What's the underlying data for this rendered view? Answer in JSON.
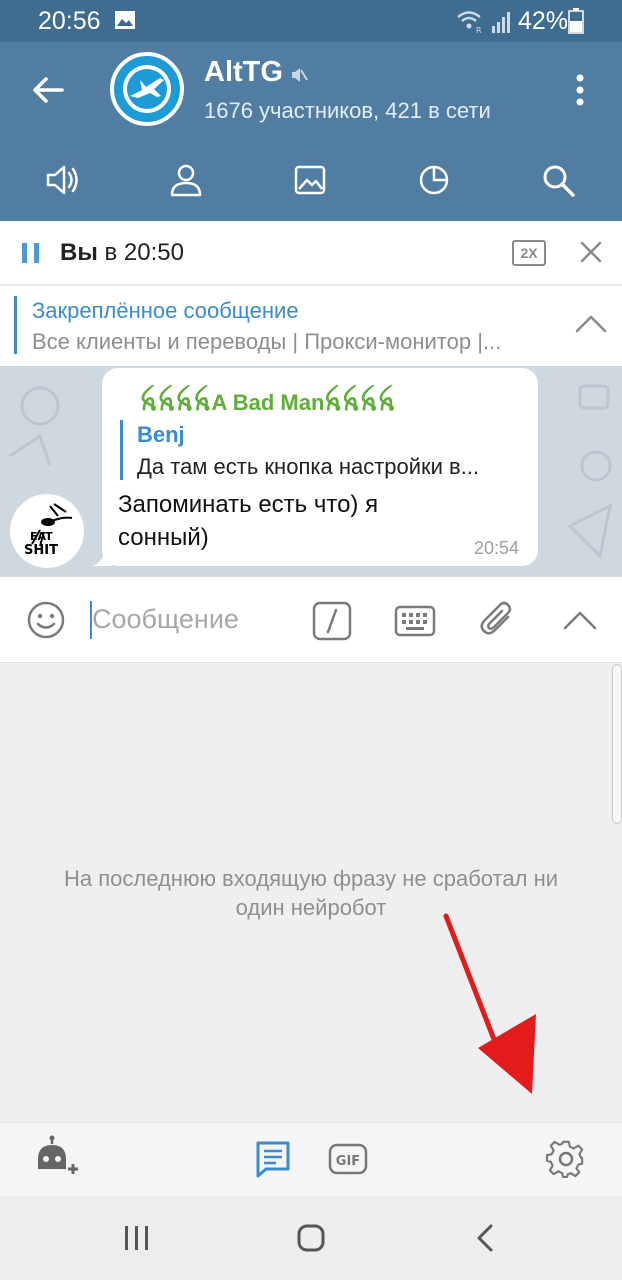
{
  "status_bar": {
    "time": "20:56",
    "battery": "42%"
  },
  "header": {
    "title": "AltTG",
    "subtitle": "1676 участников, 421 в сети",
    "tabs": [
      "audio",
      "members",
      "media",
      "history",
      "search"
    ]
  },
  "audio_player": {
    "prefix": "Вы",
    "time_text": " в 20:50",
    "speed": "2X"
  },
  "pinned": {
    "title": "Закреплённое сообщение",
    "text": "Все клиенты и переводы | Прокси-монитор |..."
  },
  "message": {
    "sender": "ꫝꫝꫝꫝA Bad Manꫝꫝꫝꫝ",
    "reply_author": "Benj",
    "reply_text": "Да там есть кнопка настройки в...",
    "text": "Запоминать есть что) я сонный)",
    "time": "20:54",
    "avatar_text": "EAT SHIT"
  },
  "input": {
    "placeholder": "Сообщение"
  },
  "panel": {
    "empty_text": "На последнюю входящую фразу не сработал ни один нейробот"
  },
  "colors": {
    "header": "#517da2",
    "status": "#3f6c91",
    "accent": "#3a8bd1",
    "sender": "#5fae3a",
    "arrow": "#e31b1b"
  }
}
